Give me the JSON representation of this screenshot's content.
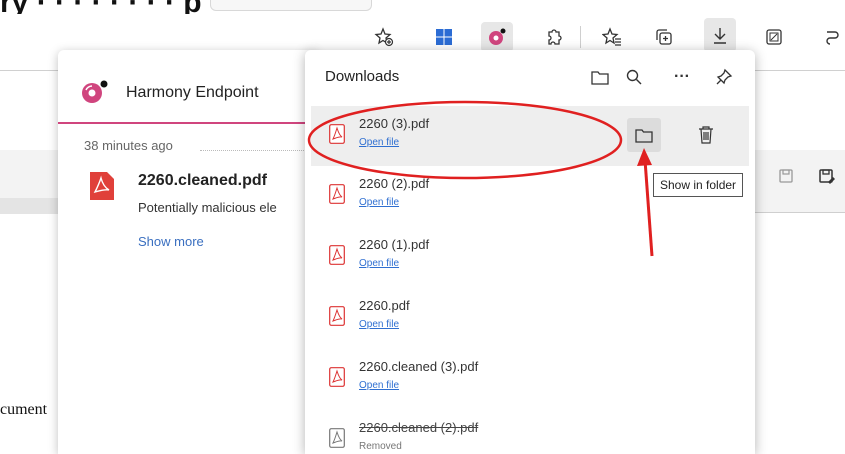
{
  "page_top_title": "ry · · · · · · · · p",
  "toolbar": {
    "icons": [
      "star-add-icon",
      "windows-icon",
      "harmony-extension-icon",
      "extensions-icon",
      "favorites-icon",
      "collections-icon",
      "downloads-icon",
      "screenshot-icon",
      "copilot-icon"
    ]
  },
  "harmony": {
    "title": "Harmony Endpoint",
    "time": "38 minutes ago",
    "file_name": "2260.cleaned.pdf",
    "description": "Potentially malicious ele",
    "show_more": "Show more"
  },
  "downloads": {
    "title": "Downloads",
    "items": [
      {
        "name": "2260 (3).pdf",
        "link": "Open file"
      },
      {
        "name": "2260 (2).pdf",
        "link": "Open file"
      },
      {
        "name": "2260 (1).pdf",
        "link": "Open file"
      },
      {
        "name": "2260.pdf",
        "link": "Open file"
      },
      {
        "name": "2260.cleaned (3).pdf",
        "link": "Open file"
      },
      {
        "name": "2260.cleaned (2).pdf",
        "status": "Removed"
      }
    ]
  },
  "tooltip": "Show in folder",
  "page_text": "cument",
  "colors": {
    "accent_pink": "#d0457e",
    "link_blue": "#2f6fd1",
    "annotation_red": "#e02020"
  }
}
